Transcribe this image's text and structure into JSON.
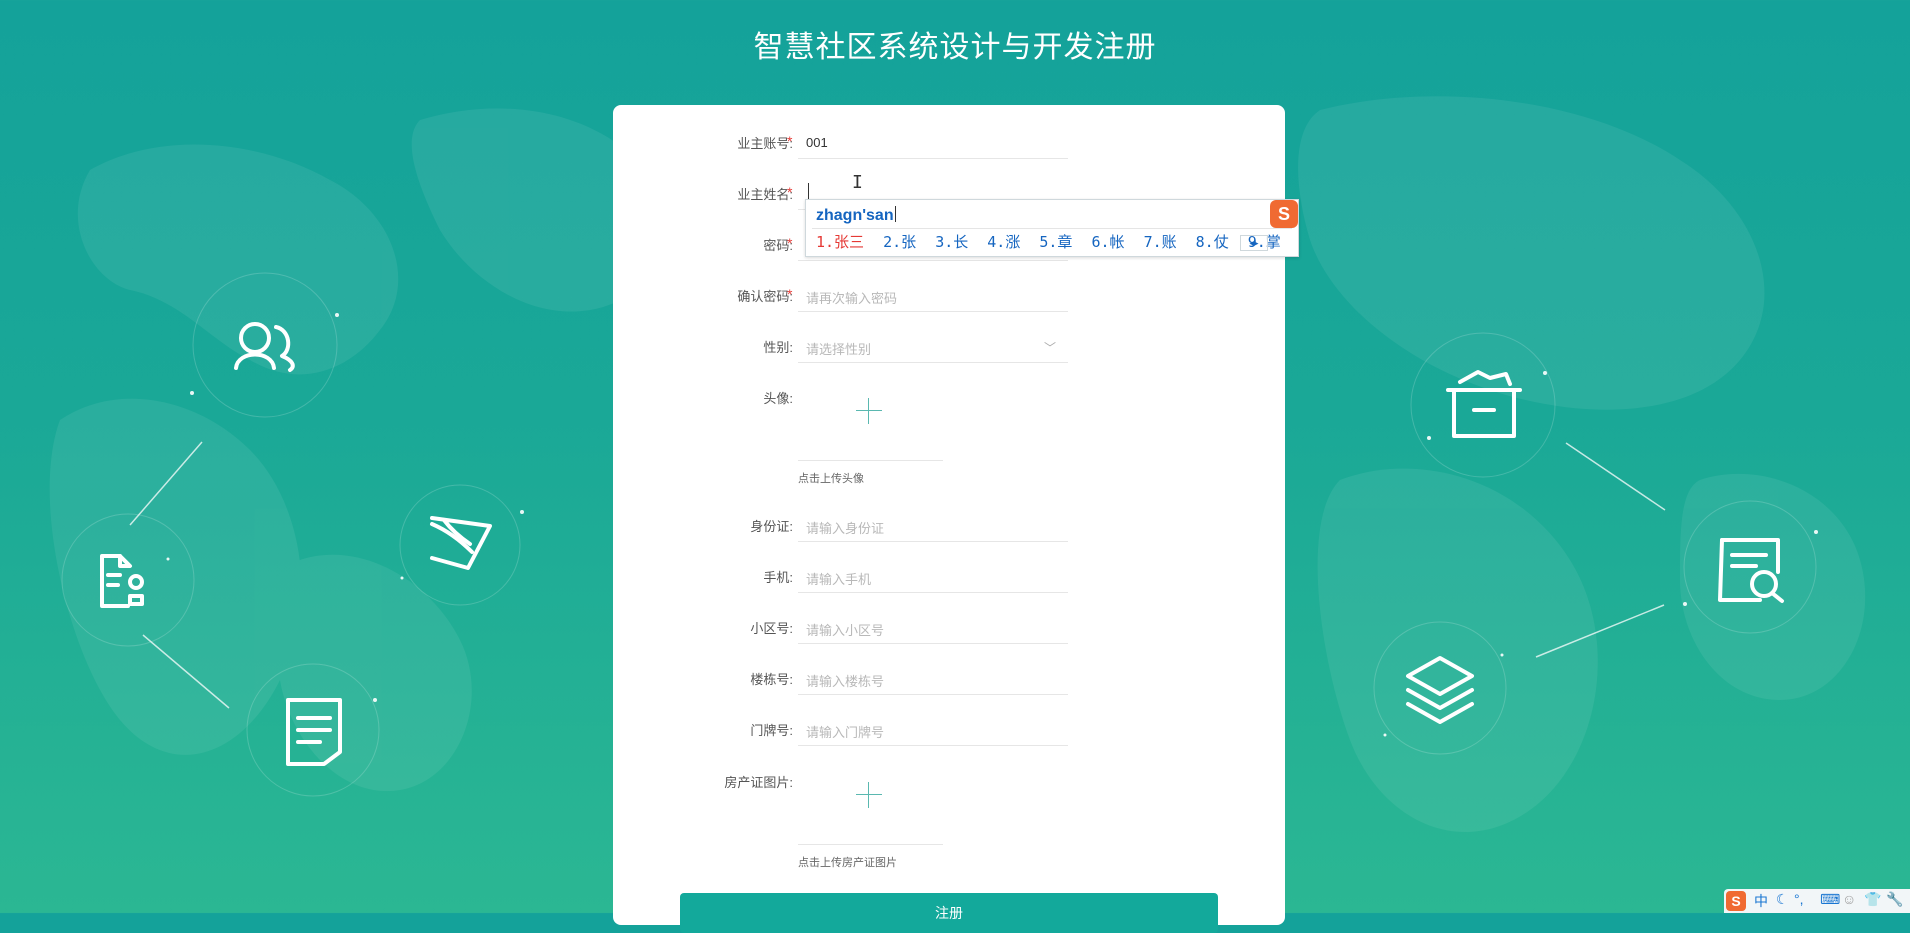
{
  "page": {
    "title": "智慧社区系统设计与开发注册"
  },
  "form": {
    "fields": {
      "owner_account": {
        "label": "业主账号:",
        "value": "001",
        "required": true
      },
      "owner_name": {
        "label": "业主姓名:",
        "value": "",
        "required": true
      },
      "password": {
        "label": "密码:",
        "value": "",
        "required": true
      },
      "confirm_password": {
        "label": "确认密码:",
        "placeholder": "请再次输入密码",
        "required": true
      },
      "gender": {
        "label": "性别:",
        "placeholder": "请选择性别"
      },
      "avatar": {
        "label": "头像:",
        "hint": "点击上传头像"
      },
      "id_card": {
        "label": "身份证:",
        "placeholder": "请输入身份证"
      },
      "phone": {
        "label": "手机:",
        "placeholder": "请输入手机"
      },
      "community_no": {
        "label": "小区号:",
        "placeholder": "请输入小区号"
      },
      "building_no": {
        "label": "楼栋号:",
        "placeholder": "请输入楼栋号"
      },
      "door_no": {
        "label": "门牌号:",
        "placeholder": "请输入门牌号"
      },
      "property_cert": {
        "label": "房产证图片:",
        "hint": "点击上传房产证图片"
      }
    },
    "required_mark": "*",
    "submit_label": "注册"
  },
  "ime": {
    "composition": "zhagn'san",
    "candidates": [
      "1.张三",
      "2.张",
      "3.长",
      "4.涨",
      "5.章",
      "6.帐",
      "7.账",
      "8.仗",
      "9.掌"
    ],
    "logo_letter": "S",
    "accent_color": "#1565c0",
    "highlight_color": "#e53935"
  },
  "tray": {
    "lang": "中",
    "punct": "°,",
    "icons": [
      "sogou-logo-icon",
      "moon-icon",
      "keyboard-icon",
      "user-icon",
      "shirt-icon",
      "wrench-icon"
    ]
  },
  "colors": {
    "background": "#18a598",
    "button": "#13a99b",
    "required": "#e53935"
  }
}
